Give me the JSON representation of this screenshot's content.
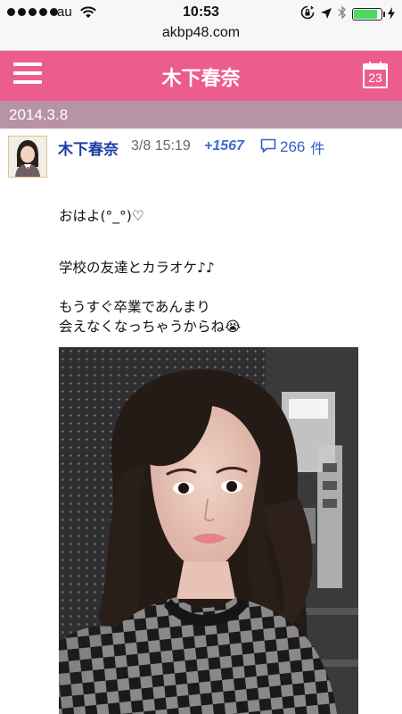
{
  "status_bar": {
    "carrier": "au",
    "time": "10:53",
    "url": "akbp48.com",
    "battery_color": "#4cd964"
  },
  "header": {
    "title": "木下春奈",
    "calendar_day": "23",
    "background": "#ec5d8e",
    "menu_icon": "hamburger-menu-icon",
    "calendar_icon": "calendar-icon"
  },
  "date_bar": {
    "date": "2014.3.8",
    "background": "#b793a5"
  },
  "post": {
    "author": "木下春奈",
    "timestamp": "3/8 15:19",
    "votes": "+1567",
    "comments_count": "266",
    "comments_unit": "件",
    "comment_icon": "speech-bubble-icon",
    "lines": [
      "おはよ(°_°)♡",
      "学校の友達とカラオケ♪♪",
      "もうすぐ卒業であんまり",
      "会えなくなっちゃうからね😭"
    ]
  }
}
